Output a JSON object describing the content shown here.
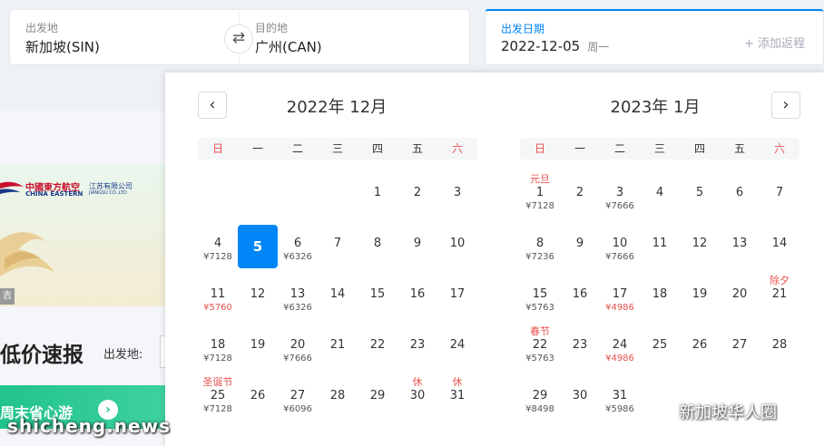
{
  "search": {
    "origin": {
      "label": "出发地",
      "value": "新加坡(SIN)"
    },
    "destination": {
      "label": "目的地",
      "value": "广州(CAN)"
    },
    "swap_icon": "⇄",
    "date": {
      "label": "出发日期",
      "value": "2022-12-05",
      "weekday": "周一"
    },
    "add_return": "+ 添加返程"
  },
  "background": {
    "airline_cn": "中國東方航空",
    "airline_en": "CHINA EASTERN",
    "airline_sub_cn": "江苏有限公司",
    "airline_sub_en": "JIANGSU CO.,LTD",
    "ad_tag": "吉",
    "promo_title": "低价速报",
    "depart_label": "出发地:",
    "weekend_label": "周末省心游",
    "weekend_arrow": "›"
  },
  "calendar": {
    "prev_icon": "‹",
    "next_icon": "›",
    "weekdays": [
      "日",
      "一",
      "二",
      "三",
      "四",
      "五",
      "六"
    ],
    "months": [
      {
        "title": "2022年 12月",
        "first_col": 4,
        "days": [
          {
            "d": "1"
          },
          {
            "d": "2"
          },
          {
            "d": "3"
          },
          {
            "d": "4",
            "p": "¥7128"
          },
          {
            "d": "5",
            "selected": true
          },
          {
            "d": "6",
            "p": "¥6326"
          },
          {
            "d": "7"
          },
          {
            "d": "8"
          },
          {
            "d": "9"
          },
          {
            "d": "10"
          },
          {
            "d": "11",
            "p": "¥5760",
            "low": true
          },
          {
            "d": "12"
          },
          {
            "d": "13",
            "p": "¥6326"
          },
          {
            "d": "14"
          },
          {
            "d": "15"
          },
          {
            "d": "16"
          },
          {
            "d": "17"
          },
          {
            "d": "18",
            "p": "¥7128"
          },
          {
            "d": "19"
          },
          {
            "d": "20",
            "p": "¥7666"
          },
          {
            "d": "21"
          },
          {
            "d": "22"
          },
          {
            "d": "23"
          },
          {
            "d": "24"
          },
          {
            "d": "25",
            "p": "¥7128",
            "h": "圣诞节"
          },
          {
            "d": "26"
          },
          {
            "d": "27",
            "p": "¥6096"
          },
          {
            "d": "28"
          },
          {
            "d": "29"
          },
          {
            "d": "30",
            "h": "休"
          },
          {
            "d": "31",
            "h": "休"
          }
        ]
      },
      {
        "title": "2023年 1月",
        "first_col": 0,
        "days": [
          {
            "d": "1",
            "p": "¥7128",
            "h": "元旦"
          },
          {
            "d": "2"
          },
          {
            "d": "3",
            "p": "¥7666"
          },
          {
            "d": "4"
          },
          {
            "d": "5"
          },
          {
            "d": "6"
          },
          {
            "d": "7"
          },
          {
            "d": "8",
            "p": "¥7236"
          },
          {
            "d": "9"
          },
          {
            "d": "10",
            "p": "¥7666"
          },
          {
            "d": "11"
          },
          {
            "d": "12"
          },
          {
            "d": "13"
          },
          {
            "d": "14"
          },
          {
            "d": "15",
            "p": "¥5763"
          },
          {
            "d": "16"
          },
          {
            "d": "17",
            "p": "¥4986",
            "low": true
          },
          {
            "d": "18"
          },
          {
            "d": "19"
          },
          {
            "d": "20"
          },
          {
            "d": "21",
            "h": "除夕"
          },
          {
            "d": "22",
            "p": "¥5763",
            "h": "春节"
          },
          {
            "d": "23"
          },
          {
            "d": "24",
            "p": "¥4986",
            "low": true
          },
          {
            "d": "25"
          },
          {
            "d": "26"
          },
          {
            "d": "27"
          },
          {
            "d": "28"
          },
          {
            "d": "29",
            "p": "¥8498"
          },
          {
            "d": "30"
          },
          {
            "d": "31",
            "p": "¥5986"
          }
        ]
      }
    ]
  },
  "watermarks": {
    "left": "shicheng.news",
    "right": "新加坡华人圈"
  },
  "colors": {
    "accent": "#0086f6",
    "holiday": "#e6514c",
    "promo_green": "#22c38e"
  }
}
